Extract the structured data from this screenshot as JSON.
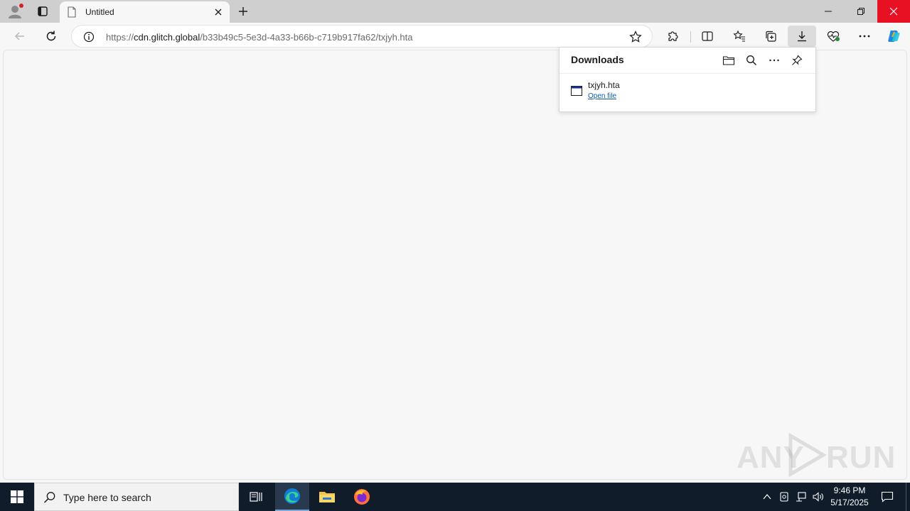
{
  "browser": {
    "tab": {
      "title": "Untitled"
    },
    "address": {
      "prefix": "https://",
      "host": "cdn.glitch.global",
      "path": "/b33b49c5-5e3d-4a33-b66b-c719b917fa62/txjyh.hta"
    }
  },
  "downloads": {
    "title": "Downloads",
    "items": [
      {
        "filename": "txjyh.hta",
        "action": "Open file"
      }
    ]
  },
  "watermark": {
    "left": "ANY",
    "right": "RUN"
  },
  "taskbar": {
    "search_placeholder": "Type here to search",
    "time": "9:46 PM",
    "date": "5/17/2025"
  },
  "colors": {
    "accent": "#0b5cad",
    "close_red": "#e81123",
    "taskbar": "#101c2a"
  }
}
